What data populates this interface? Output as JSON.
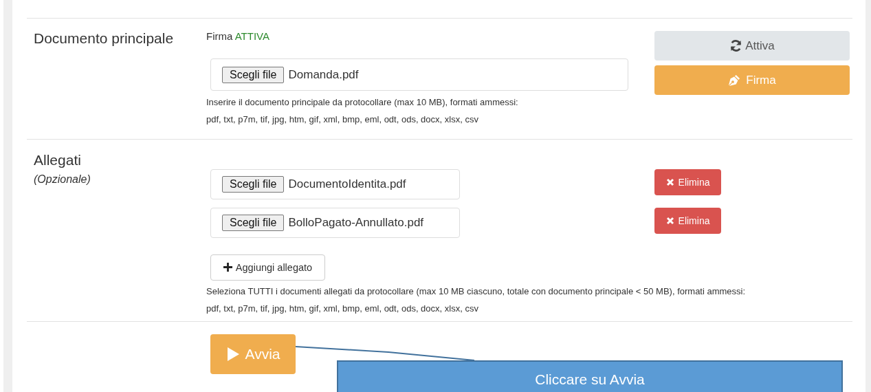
{
  "main_document": {
    "label": "Documento principale",
    "signature": {
      "label": "Firma",
      "value": "ATTIVA",
      "active": true
    },
    "file": {
      "button": "Scegli file",
      "value": "Domanda.pdf"
    },
    "help": "Inserire il documento principale da protocollare (max 10 MB), formati ammessi:",
    "formats": "pdf, txt, p7m, tif, jpg, htm, gif, xml, bmp, eml, odt, ods, docx, xlsx, csv",
    "activate_button": {
      "label": "Attiva",
      "disabled": true
    },
    "sign_button": {
      "label": "Firma"
    }
  },
  "attachments": {
    "label": "Allegati",
    "note": "(Opzionale)",
    "files": [
      {
        "button": "Scegli file",
        "value": "DocumentoIdentita.pdf",
        "remove": "Elimina"
      },
      {
        "button": "Scegli file",
        "value": "BolloPagato-Annullato.pdf",
        "remove": "Elimina"
      }
    ],
    "add_button": "Aggiungi allegato",
    "help": "Seleziona TUTTI i documenti allegati da protocollare (max 10 MB ciascuno, totale con documento principale < 50 MB), formati ammessi:",
    "formats": "pdf, txt, p7m, tif, jpg, htm, gif, xml, bmp, eml, odt, ods, docx, xlsx, csv"
  },
  "start_button": "Avvia",
  "callout": "Cliccare su Avvia"
}
